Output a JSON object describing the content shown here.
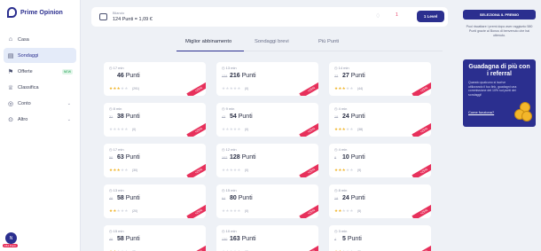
{
  "brand": {
    "name": "Prime Opinion"
  },
  "sidebar": {
    "items": [
      {
        "label": "Casa",
        "icon": "home-icon",
        "active": false
      },
      {
        "label": "Sondaggi",
        "icon": "survey-icon",
        "active": true
      },
      {
        "label": "Offerte",
        "icon": "offers-icon",
        "active": false,
        "badge": "NEW"
      },
      {
        "label": "Classifica",
        "icon": "trophy-icon",
        "active": false
      },
      {
        "label": "Conto",
        "icon": "account-icon",
        "active": false
      },
      {
        "label": "Altro",
        "icon": "more-icon",
        "active": false
      }
    ],
    "avatar_initial": "N",
    "avatar_tag": "154 Punti"
  },
  "topbar": {
    "balance_label": "Bilancio",
    "balance_value": "124 Punti = 1,09 €",
    "notif_count": "1",
    "level_label": "1 Level"
  },
  "tabs": [
    "Miglior abbinamento",
    "Sondaggi brevi",
    "Più Punti"
  ],
  "cards": [
    {
      "time": "17 min",
      "old": "",
      "points": "46",
      "stars": 3,
      "count": "(291)"
    },
    {
      "time": "13 min",
      "old": "174",
      "points": "216",
      "stars": 0,
      "count": "(0)"
    },
    {
      "time": "14 min",
      "old": "22",
      "points": "27",
      "stars": 3,
      "count": "(44)"
    },
    {
      "time": "8 min",
      "old": "31",
      "points": "38",
      "stars": 0,
      "count": "(0)"
    },
    {
      "time": "9 min",
      "old": "43",
      "points": "54",
      "stars": 0,
      "count": "(0)"
    },
    {
      "time": "4 min",
      "old": "19",
      "points": "24",
      "stars": 3,
      "count": "(38)"
    },
    {
      "time": "17 min",
      "old": "50",
      "points": "63",
      "stars": 3,
      "count": "(30)"
    },
    {
      "time": "12 min",
      "old": "102",
      "points": "128",
      "stars": 0,
      "count": "(0)"
    },
    {
      "time": "4 min",
      "old": "8",
      "points": "10",
      "stars": 3,
      "count": "(9)"
    },
    {
      "time": "13 min",
      "old": "46",
      "points": "58",
      "stars": 2,
      "count": "(20)"
    },
    {
      "time": "15 min",
      "old": "64",
      "points": "80",
      "stars": 0,
      "count": "(0)"
    },
    {
      "time": "8 min",
      "old": "19",
      "points": "24",
      "stars": 2,
      "count": "(5)"
    },
    {
      "time": "15 min",
      "old": "46",
      "points": "58",
      "stars": 2,
      "count": "(8)"
    },
    {
      "time": "10 min",
      "old": "130",
      "points": "163",
      "stars": 0,
      "count": "(0)"
    },
    {
      "time": "3 min",
      "old": "4",
      "points": "5",
      "stars": 2,
      "count": "(5)"
    }
  ],
  "points_suffix": "Punti",
  "ribbon_text": "+25%",
  "right": {
    "premio_button": "SELEZIONA IL PREMIO",
    "premio_text": "Puoi riscattare i premi dopo aver raggiunto 580 Punti grazie al Bonus di benvenuto che hai ottenuto.",
    "promo_title": "Guadagna di più con i referral",
    "promo_body": "Quando qualcuno si iscrive utilizzando il tuo link, guadagni una commissione del 10% sui punti dei sondaggi!",
    "promo_link": "Come funziona?"
  },
  "colors": {
    "brand": "#2b2f8f",
    "accent": "#e7305b",
    "star": "#f0b429"
  }
}
